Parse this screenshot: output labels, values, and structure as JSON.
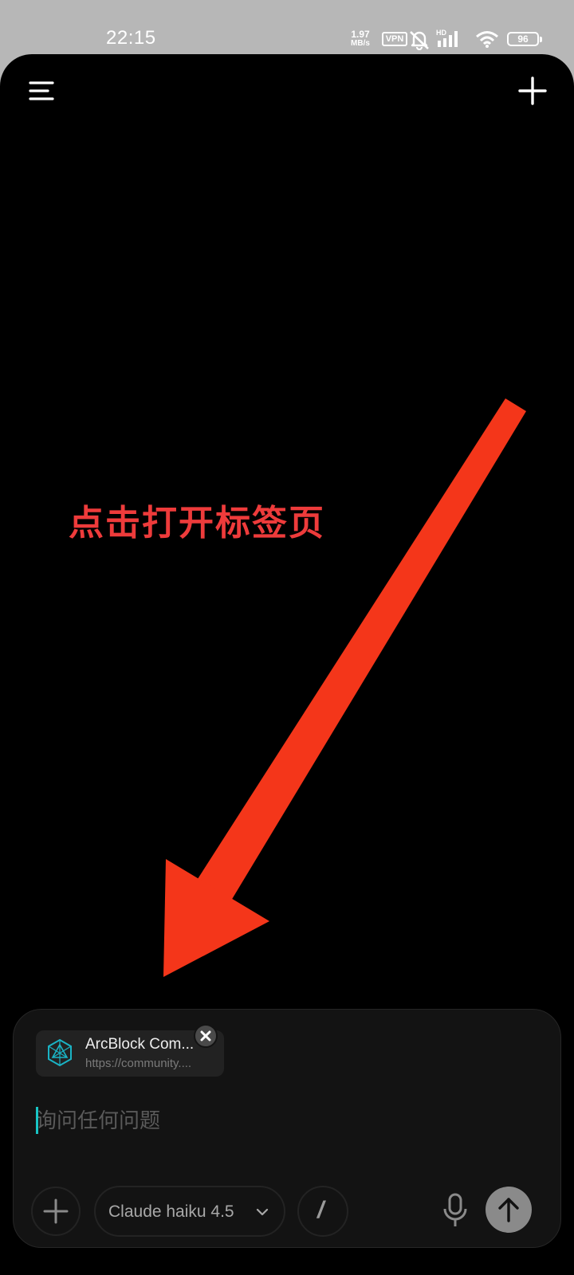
{
  "status_bar": {
    "time": "22:15",
    "net_speed_value": "1.97",
    "net_speed_unit": "MB/s",
    "vpn_label": "VPN",
    "signal_tag": "HD",
    "battery": "96",
    "icons": [
      "mute-bell-icon",
      "cellular-signal-icon",
      "wifi-icon",
      "battery-icon"
    ]
  },
  "header": {
    "menu_icon": "menu-icon",
    "new_chat_icon": "plus-icon"
  },
  "annotation": {
    "text": "点击打开标签页",
    "color": "#ee3b3b",
    "arrow_color": "#f4361a"
  },
  "composer": {
    "attached_tab": {
      "title": "ArcBlock Com...",
      "url": "https://community....",
      "favicon": "arcblock-logo-icon",
      "close_icon": "close-icon"
    },
    "input": {
      "value": "",
      "placeholder": "询问任何问题"
    },
    "toolbar": {
      "attach_icon": "plus-icon",
      "model_label": "Claude haiku 4.5",
      "model_chevron": "chevron-down-icon",
      "slash_label": "/",
      "mic_icon": "microphone-icon",
      "send_icon": "arrow-up-icon"
    },
    "accent_color": "#18c5c5"
  }
}
